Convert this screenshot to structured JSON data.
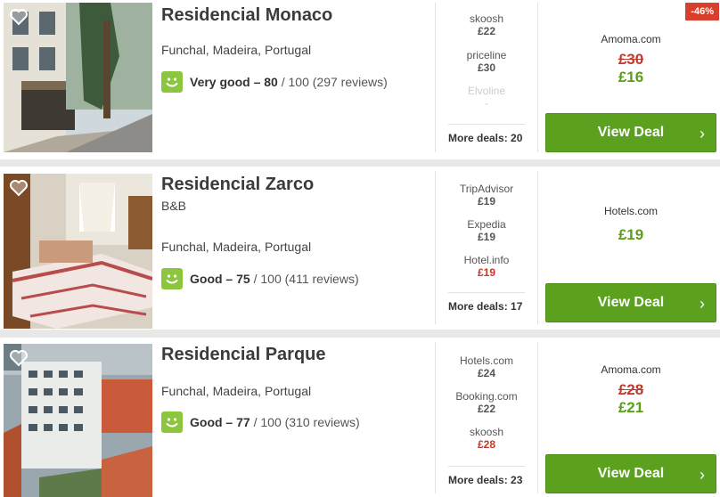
{
  "accent_green": "#5ba11f",
  "discount_red": "#d9402b",
  "hotels": [
    {
      "name": "Residencial Monaco",
      "type": "",
      "location": "Funchal, Madeira, Portugal",
      "rating_label": "Very good",
      "rating_score": "80",
      "rating_rest": "/ 100 (297 reviews)",
      "rating_separator": " – ",
      "deals": [
        {
          "site": "skoosh",
          "price": "£22",
          "highlight": false,
          "faded": false
        },
        {
          "site": "priceline",
          "price": "£30",
          "highlight": false,
          "faded": false
        },
        {
          "site": "Elvoline",
          "price": "-",
          "highlight": false,
          "faded": true
        }
      ],
      "more_deals": "More deals: 20",
      "best_provider": "Amoma.com",
      "old_price": "£30",
      "new_price": "£16",
      "discount": "-46%",
      "button_label": "View Deal",
      "chevron": "›"
    },
    {
      "name": "Residencial Zarco",
      "type": "B&B",
      "location": "Funchal, Madeira, Portugal",
      "rating_label": "Good",
      "rating_score": "75",
      "rating_rest": "/ 100 (411 reviews)",
      "rating_separator": " – ",
      "deals": [
        {
          "site": "TripAdvisor",
          "price": "£19",
          "highlight": false,
          "faded": false
        },
        {
          "site": "Expedia",
          "price": "£19",
          "highlight": false,
          "faded": false
        },
        {
          "site": "Hotel.info",
          "price": "£19",
          "highlight": true,
          "faded": false
        }
      ],
      "more_deals": "More deals: 17",
      "best_provider": "Hotels.com",
      "old_price": "",
      "new_price": "£19",
      "discount": "",
      "button_label": "View Deal",
      "chevron": "›"
    },
    {
      "name": "Residencial Parque",
      "type": "",
      "location": "Funchal, Madeira, Portugal",
      "rating_label": "Good",
      "rating_score": "77",
      "rating_rest": "/ 100 (310 reviews)",
      "rating_separator": " – ",
      "deals": [
        {
          "site": "Hotels.com",
          "price": "£24",
          "highlight": false,
          "faded": false
        },
        {
          "site": "Booking.com",
          "price": "£22",
          "highlight": false,
          "faded": false
        },
        {
          "site": "skoosh",
          "price": "£28",
          "highlight": true,
          "faded": false
        }
      ],
      "more_deals": "More deals: 23",
      "best_provider": "Amoma.com",
      "old_price": "£28",
      "new_price": "£21",
      "discount": "",
      "button_label": "View Deal",
      "chevron": "›"
    }
  ]
}
